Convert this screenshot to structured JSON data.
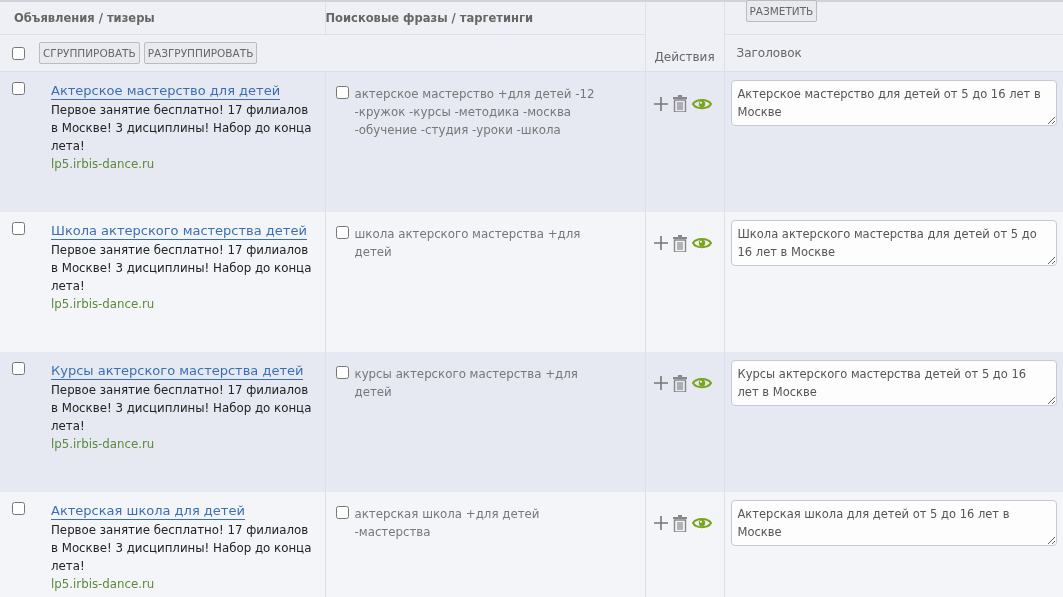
{
  "header": {
    "ads_column": "Объявления / тизеры",
    "phrases_column": "Поисковые фразы / таргетинги",
    "actions_column": "Действия",
    "markup_button": "РАЗМЕТИТЬ",
    "title_column": "Заголовок",
    "select_all": {
      "checked": false
    },
    "group_button": "СГРУППИРОВАТЬ",
    "ungroup_button": "РАЗГРУППИРОВАТЬ"
  },
  "rows": [
    {
      "checked": false,
      "ad_title": "Актерское мастерство для детей",
      "ad_text": "Первое занятие бесплатно! 17 филиалов в Москве! 3 дисциплины! Набор до конца лета!",
      "ad_url": "lp5.irbis-dance.ru",
      "phrase_checked": false,
      "phrases": "актерское мастерство +для детей -12 -кружок -курсы -методика -москва -обучение -студия -уроки -школа",
      "title_value": "Актерское мастерство для детей от 5 до 16 лет в Москве"
    },
    {
      "checked": false,
      "ad_title": "Школа актерского мастерства детей",
      "ad_text": "Первое занятие бесплатно! 17 филиалов в Москве! 3 дисциплины! Набор до конца лета!",
      "ad_url": "lp5.irbis-dance.ru",
      "phrase_checked": false,
      "phrases": "школа актерского мастерства +для детей",
      "title_value": "Школа актерского мастерства для детей от 5 до 16 лет в Москве"
    },
    {
      "checked": false,
      "ad_title": "Курсы актерского мастерства детей",
      "ad_text": "Первое занятие бесплатно! 17 филиалов в Москве! 3 дисциплины! Набор до конца лета!",
      "ad_url": "lp5.irbis-dance.ru",
      "phrase_checked": false,
      "phrases": "курсы актерского мастерства +для детей",
      "title_value": "Курсы актерского мастерства детей от 5 до 16 лет в Москве"
    },
    {
      "checked": false,
      "ad_title": "Актерская школа для детей",
      "ad_text": "Первое занятие бесплатно! 17 филиалов в Москве! 3 дисциплины! Набор до конца лета!",
      "ad_url": "lp5.irbis-dance.ru",
      "phrase_checked": false,
      "phrases": "актерская школа +для детей -мастерства",
      "title_value": "Актерская школа для детей от 5 до 16 лет в Москве"
    }
  ]
}
